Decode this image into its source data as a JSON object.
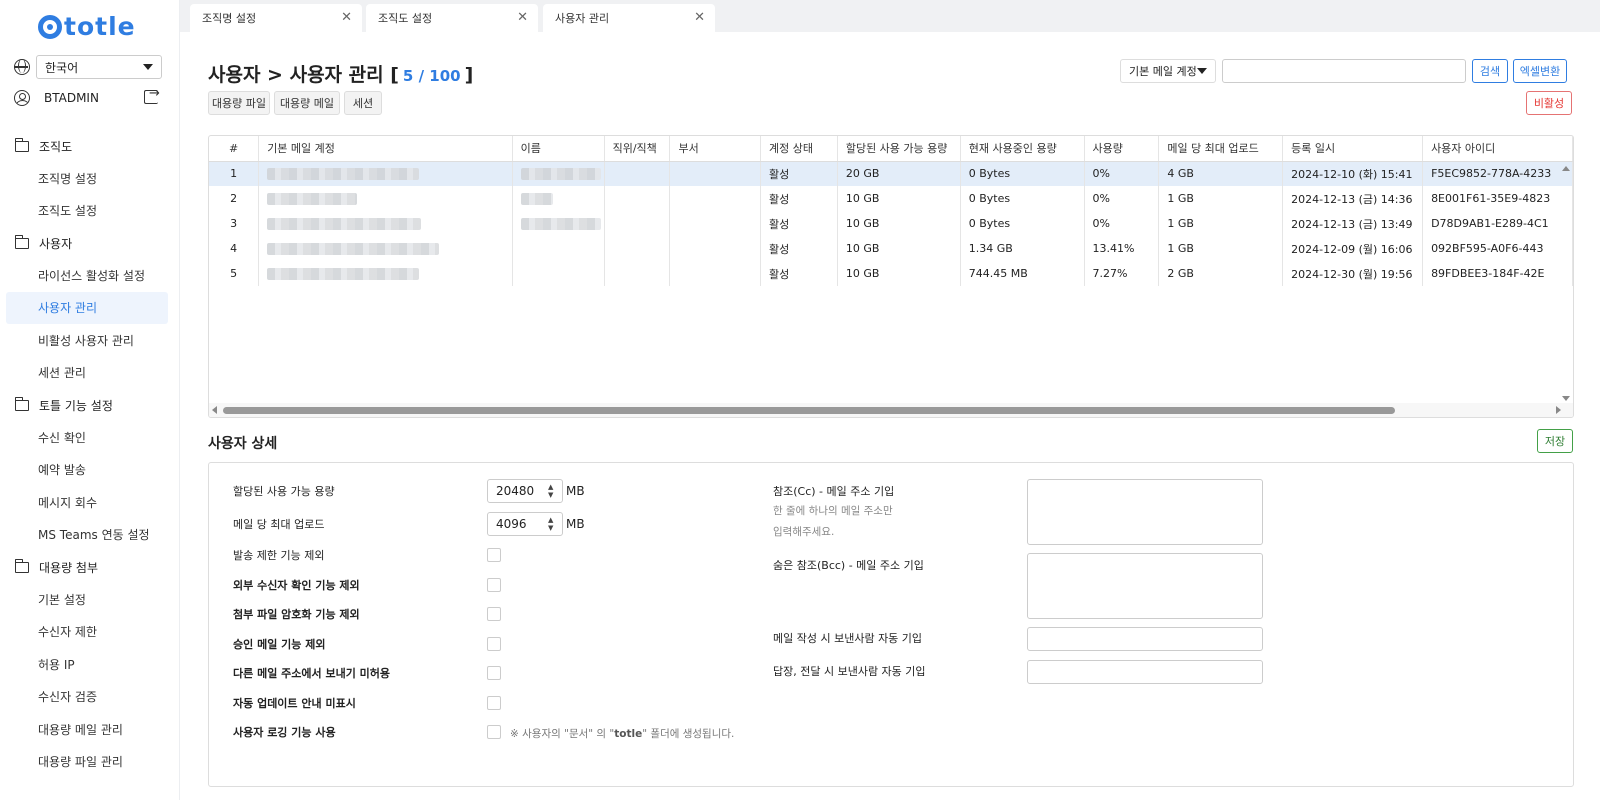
{
  "app": {
    "logo_text": "totle"
  },
  "sidebar": {
    "language": "한국어",
    "username": "BTADMIN",
    "groups": [
      {
        "label": "조직도",
        "items": [
          {
            "label": "조직명 설정"
          },
          {
            "label": "조직도 설정"
          }
        ]
      },
      {
        "label": "사용자",
        "items": [
          {
            "label": "라이선스 활성화 설정"
          },
          {
            "label": "사용자 관리",
            "active": true
          },
          {
            "label": "비활성 사용자 관리"
          },
          {
            "label": "세션 관리"
          }
        ]
      },
      {
        "label": "토틀 기능 설정",
        "items": [
          {
            "label": "수신 확인"
          },
          {
            "label": "예약 발송"
          },
          {
            "label": "메시지 회수"
          },
          {
            "label": "MS Teams 연동 설정"
          }
        ]
      },
      {
        "label": "대용량 첨부",
        "items": [
          {
            "label": "기본 설정"
          },
          {
            "label": "수신자 제한"
          },
          {
            "label": "허용 IP"
          },
          {
            "label": "수신자 검증"
          },
          {
            "label": "대용량 메일 관리"
          },
          {
            "label": "대용량 파일 관리"
          }
        ]
      }
    ]
  },
  "tabs": [
    {
      "label": "조직명 설정"
    },
    {
      "label": "조직도 설정"
    },
    {
      "label": "사용자 관리"
    }
  ],
  "page": {
    "title": "사용자 > 사용자 관리 [",
    "count": "5 / 100",
    "title_end": "]",
    "buttons": {
      "bulk_file": "대용량 파일",
      "bulk_mail": "대용량 메일",
      "session": "세션",
      "search": "검색",
      "excel": "엑셀변환",
      "inactive": "비활성",
      "save": "저장"
    },
    "search_select": "기본 메일 계정",
    "search_value": ""
  },
  "table": {
    "columns": [
      "#",
      "기본 메일 계정",
      "이름",
      "직위/직책",
      "부서",
      "계정 상태",
      "할당된 사용 가능 용량",
      "현재 사용중인 용량",
      "사용량",
      "메일 당 최대 업로드",
      "등록 일시",
      "사용자 아이디"
    ],
    "rows": [
      {
        "no": "1",
        "status": "활성",
        "quota": "20 GB",
        "used": "0 Bytes",
        "usage": "0%",
        "max_upload": "4 GB",
        "registered": "2024-12-10 (화) 15:41",
        "user_id": "F5EC9852-778A-4233"
      },
      {
        "no": "2",
        "status": "활성",
        "quota": "10 GB",
        "used": "0 Bytes",
        "usage": "0%",
        "max_upload": "1 GB",
        "registered": "2024-12-13 (금) 14:36",
        "user_id": "8E001F61-35E9-4823"
      },
      {
        "no": "3",
        "status": "활성",
        "quota": "10 GB",
        "used": "0 Bytes",
        "usage": "0%",
        "max_upload": "1 GB",
        "registered": "2024-12-13 (금) 13:49",
        "user_id": "D78D9AB1-E289-4C1"
      },
      {
        "no": "4",
        "status": "활성",
        "quota": "10 GB",
        "used": "1.34 GB",
        "usage": "13.41%",
        "max_upload": "1 GB",
        "registered": "2024-12-09 (월) 16:06",
        "user_id": "092BF595-A0F6-443"
      },
      {
        "no": "5",
        "status": "활성",
        "quota": "10 GB",
        "used": "744.45 MB",
        "usage": "7.27%",
        "max_upload": "2 GB",
        "registered": "2024-12-30 (월) 19:56",
        "user_id": "89FDBEE3-184F-42E"
      }
    ]
  },
  "detail": {
    "title": "사용자 상세",
    "quota_label": "할당된 사용 가능 용량",
    "quota_value": "20480",
    "max_upload_label": "메일 당 최대 업로드",
    "max_upload_value": "4096",
    "unit": "MB",
    "checks": [
      {
        "label": "발송 제한 기능 제외",
        "checked": false
      },
      {
        "label": "외부 수신자 확인 기능 제외",
        "checked": false
      },
      {
        "label": "첨부 파일 암호화 기능 제외",
        "checked": false
      },
      {
        "label": "승인 메일 기능 제외",
        "checked": false
      },
      {
        "label": "다른 메일 주소에서 보내기 미허용",
        "checked": false
      },
      {
        "label": "자동 업데이트 안내 미표시",
        "checked": false
      },
      {
        "label": "사용자 로깅 기능 사용",
        "checked": false
      }
    ],
    "logging_note_pre": "※ 사용자의 \"문서\" 의 \"",
    "logging_note_bold": "totle",
    "logging_note_post": "\" 폴더에 생성됩니다.",
    "cc_label": "참조(Cc) - 메일 주소 기입",
    "cc_hint_1": "한 줄에 하나의 메일 주소만",
    "cc_hint_2": "입력해주세요.",
    "bcc_label": "숨은 참조(Bcc) - 메일 주소 기입",
    "auto_sender_compose_label": "메일 작성 시 보낸사람 자동 기입",
    "auto_sender_reply_label": "답장, 전달 시 보낸사람 자동 기입"
  }
}
